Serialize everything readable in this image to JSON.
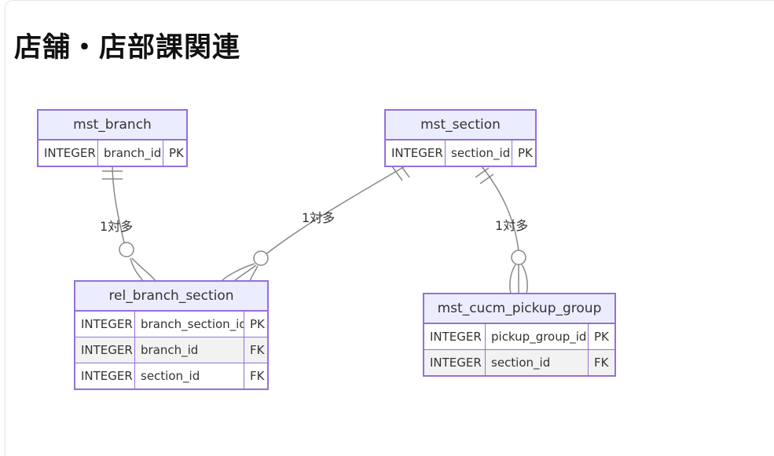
{
  "page": {
    "title": "店舗・店部課関連"
  },
  "entities": {
    "mst_branch": {
      "name": "mst_branch",
      "rows": [
        {
          "type": "INTEGER",
          "column": "branch_id",
          "key": "PK"
        }
      ]
    },
    "mst_section": {
      "name": "mst_section",
      "rows": [
        {
          "type": "INTEGER",
          "column": "section_id",
          "key": "PK"
        }
      ]
    },
    "rel_branch_section": {
      "name": "rel_branch_section",
      "rows": [
        {
          "type": "INTEGER",
          "column": "branch_section_id",
          "key": "PK"
        },
        {
          "type": "INTEGER",
          "column": "branch_id",
          "key": "FK"
        },
        {
          "type": "INTEGER",
          "column": "section_id",
          "key": "FK"
        }
      ]
    },
    "mst_cucm_pickup_group": {
      "name": "mst_cucm_pickup_group",
      "rows": [
        {
          "type": "INTEGER",
          "column": "pickup_group_id",
          "key": "PK"
        },
        {
          "type": "INTEGER",
          "column": "section_id",
          "key": "FK"
        }
      ]
    }
  },
  "relationships": [
    {
      "from": "mst_branch",
      "to": "rel_branch_section",
      "label": "1対多"
    },
    {
      "from": "mst_section",
      "to": "rel_branch_section",
      "label": "1対多"
    },
    {
      "from": "mst_section",
      "to": "mst_cucm_pickup_group",
      "label": "1対多"
    }
  ],
  "colors": {
    "entity_border": "#9370db",
    "entity_header": "#ececff",
    "alt_row": "#f2f2f2",
    "line": "#888888"
  }
}
